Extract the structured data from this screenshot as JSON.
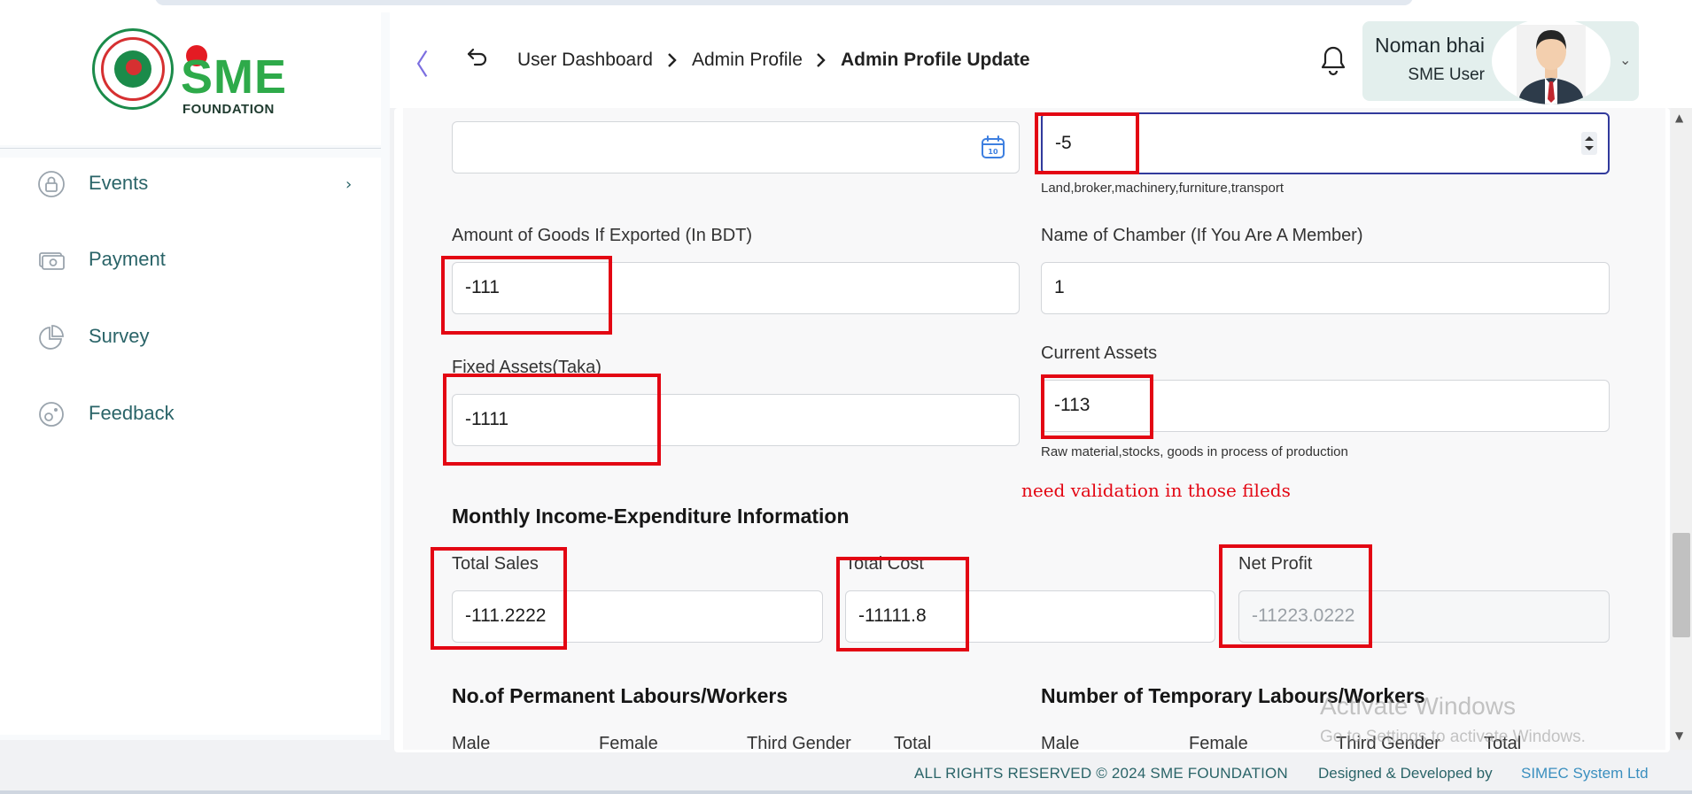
{
  "brand": {
    "logo_word": "SME",
    "logo_sub": "FOUNDATION"
  },
  "sidebar": {
    "items": [
      {
        "label": "Events",
        "icon": "lock-icon",
        "has_arrow": true
      },
      {
        "label": "Payment",
        "icon": "banknote-icon"
      },
      {
        "label": "Survey",
        "icon": "pie-chart-icon"
      },
      {
        "label": "Feedback",
        "icon": "feedback-icon"
      }
    ]
  },
  "header": {
    "collapse_glyph": "〈",
    "breadcrumb": [
      "User Dashboard",
      "Admin Profile",
      "Admin Profile Update"
    ],
    "user": {
      "name": "Noman bhai",
      "role": "SME User"
    }
  },
  "form": {
    "date_field": {
      "value": ""
    },
    "number_field": {
      "value": "-5",
      "hint": "Land,broker,machinery,furniture,transport"
    },
    "exported": {
      "label": "Amount of Goods If Exported (In BDT)",
      "value": "-111"
    },
    "chamber": {
      "label": "Name of Chamber (If You Are A Member)",
      "value": "1"
    },
    "fixed_assets": {
      "label": "Fixed Assets(Taka)",
      "value": "-1111"
    },
    "current_assets": {
      "label": "Current Assets",
      "value": "-113",
      "hint": "Raw material,stocks, goods in process of production"
    },
    "monthly_section": "Monthly Income-Expenditure Information",
    "total_sales": {
      "label": "Total Sales",
      "value": "-111.2222"
    },
    "total_cost": {
      "label": "Total Cost",
      "value": "-11111.8"
    },
    "net_profit": {
      "label": "Net Profit",
      "value": "-11223.0222"
    },
    "permanent_section": "No.of Permanent Labours/Workers",
    "temporary_section": "Number of Temporary Labours/Workers",
    "labour_columns": [
      "Male",
      "Female",
      "Third Gender",
      "Total"
    ]
  },
  "annotation": {
    "text": "need validation in those fileds",
    "color": "#e30613"
  },
  "watermark": {
    "title": "Activate Windows",
    "sub": "Go to Settings to activate Windows."
  },
  "footer": {
    "copyright": "ALL RIGHTS RESERVED © 2024 SME FOUNDATION",
    "designed_by": "Designed & Developed by",
    "developer": "SIMEC System Ltd"
  },
  "colors": {
    "accent": "#2a6468",
    "annotation": "#e30613",
    "focus": "#313a9c",
    "brand_green": "#2eaa4a",
    "brand_red": "#e41b23"
  }
}
